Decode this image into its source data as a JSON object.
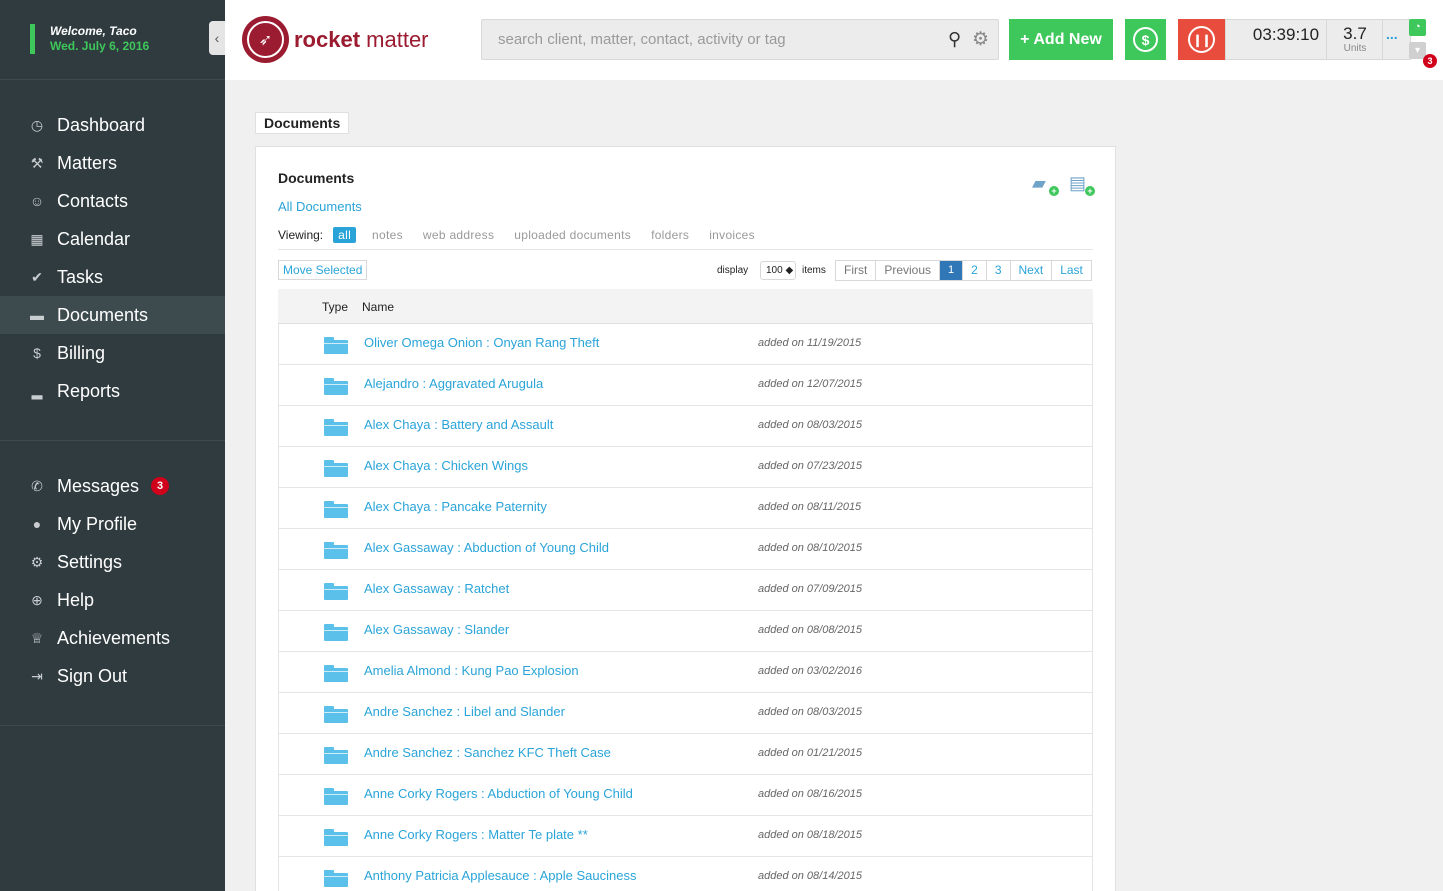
{
  "user": {
    "welcome": "Welcome, Taco",
    "date": "Wed. July 6, 2016"
  },
  "nav_main": [
    {
      "label": "Dashboard",
      "icon": "dashboard-icon",
      "glyph": "◷"
    },
    {
      "label": "Matters",
      "icon": "gavel-icon",
      "glyph": "⚒"
    },
    {
      "label": "Contacts",
      "icon": "contacts-icon",
      "glyph": "👥"
    },
    {
      "label": "Calendar",
      "icon": "calendar-icon",
      "glyph": "▭"
    },
    {
      "label": "Tasks",
      "icon": "check-icon",
      "glyph": "✔"
    },
    {
      "label": "Documents",
      "icon": "folder-icon",
      "glyph": "▬"
    },
    {
      "label": "Billing",
      "icon": "dollar-icon",
      "glyph": "$"
    },
    {
      "label": "Reports",
      "icon": "bar-chart-icon",
      "glyph": "▁▃▅"
    }
  ],
  "nav_secondary": [
    {
      "label": "Messages",
      "icon": "phone-icon",
      "glyph": "✆",
      "badge": "3"
    },
    {
      "label": "My Profile",
      "icon": "user-icon",
      "glyph": "👤"
    },
    {
      "label": "Settings",
      "icon": "gear-icon",
      "glyph": "⚙"
    },
    {
      "label": "Help",
      "icon": "lifebuoy-icon",
      "glyph": "⊕"
    },
    {
      "label": "Achievements",
      "icon": "trophy-icon",
      "glyph": "🏆"
    },
    {
      "label": "Sign Out",
      "icon": "sign-out-icon",
      "glyph": "⇥"
    }
  ],
  "header": {
    "logo_text_bold": "rocket",
    "logo_text": " matter",
    "search_placeholder": "search client, matter, contact, activity or tag",
    "add_new": "+ Add New",
    "timer": "03:39:10",
    "units_value": "3.7",
    "units_label": "Units",
    "more": "...",
    "notification_count": "3"
  },
  "breadcrumb": "Documents",
  "panel": {
    "title": "Documents",
    "all_documents": "All Documents",
    "viewing_label": "Viewing:",
    "filters": [
      "all",
      "notes",
      "web address",
      "uploaded documents",
      "folders",
      "invoices"
    ],
    "move_selected": "Move Selected",
    "display_label": "display",
    "display_value": "100 ◆",
    "items_label": "items",
    "pager": [
      "First",
      "Previous",
      "1",
      "2",
      "3",
      "Next",
      "Last"
    ],
    "col_type": "Type",
    "col_name": "Name"
  },
  "documents": [
    {
      "name": "Oliver Omega Onion : Onyan Rang Theft",
      "added": "added on 11/19/2015"
    },
    {
      "name": "Alejandro : Aggravated Arugula",
      "added": "added on 12/07/2015"
    },
    {
      "name": "Alex Chaya : Battery and Assault",
      "added": "added on 08/03/2015"
    },
    {
      "name": "Alex Chaya : Chicken Wings",
      "added": "added on 07/23/2015"
    },
    {
      "name": "Alex Chaya : Pancake Paternity",
      "added": "added on 08/11/2015"
    },
    {
      "name": "Alex Gassaway : Abduction of Young Child",
      "added": "added on 08/10/2015"
    },
    {
      "name": "Alex Gassaway : Ratchet",
      "added": "added on 07/09/2015"
    },
    {
      "name": "Alex Gassaway : Slander",
      "added": "added on 08/08/2015"
    },
    {
      "name": "Amelia Almond : Kung Pao Explosion",
      "added": "added on 03/02/2016"
    },
    {
      "name": "Andre Sanchez : Libel and Slander",
      "added": "added on 08/03/2015"
    },
    {
      "name": "Andre Sanchez : Sanchez KFC Theft Case",
      "added": "added on 01/21/2015"
    },
    {
      "name": "Anne Corky Rogers : Abduction of Young Child",
      "added": "added on 08/16/2015"
    },
    {
      "name": "Anne Corky Rogers : Matter Te plate **",
      "added": "added on 08/18/2015"
    },
    {
      "name": "Anthony Patricia Applesauce : Apple Sauciness",
      "added": "added on 08/14/2015"
    }
  ],
  "colors": {
    "accent": "#2aa4d8",
    "green": "#3ec75a",
    "red": "#e74c3c",
    "brand": "#9b1b30",
    "sidebar": "#2f3b3f"
  }
}
